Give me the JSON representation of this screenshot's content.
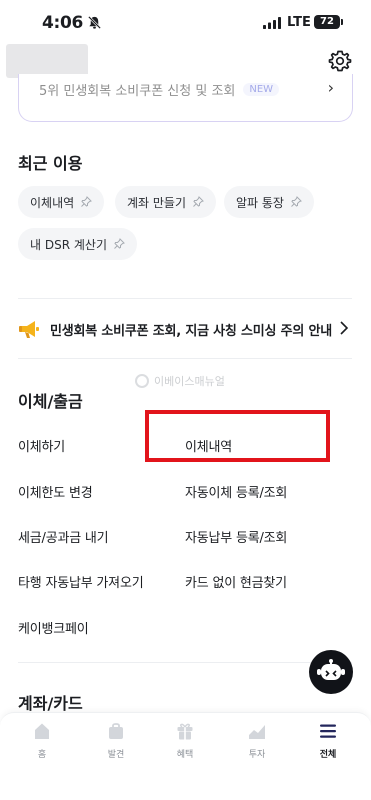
{
  "status_bar": {
    "time": "4:06",
    "network": "LTE",
    "battery": "72"
  },
  "notice_card": {
    "text": "5위 민생회복 소비쿠폰 신청 및 조회",
    "badge": "NEW",
    "chevron": "›"
  },
  "recent": {
    "title": "최근 이용",
    "chips": [
      {
        "label": "이체내역"
      },
      {
        "label": "계좌 만들기"
      },
      {
        "label": "알파 통장"
      },
      {
        "label": "내 DSR 계산기"
      }
    ]
  },
  "banner": {
    "text": "민생회복 소비쿠폰 조회, 지금 사칭 스미싱 주의 안내"
  },
  "watermark": {
    "text": "이베이스매뉴얼"
  },
  "transfer": {
    "title": "이체/출금",
    "items": [
      {
        "label": "이체하기"
      },
      {
        "label": "이체내역"
      },
      {
        "label": "이체한도 변경"
      },
      {
        "label": "자동이체 등록/조회"
      },
      {
        "label": "세금/공과금 내기"
      },
      {
        "label": "자동납부 등록/조회"
      },
      {
        "label": "타행 자동납부 가져오기"
      },
      {
        "label": "카드 없이 현금찾기"
      },
      {
        "label": "케이뱅크페이"
      }
    ]
  },
  "account_card": {
    "title": "계좌/카드"
  },
  "tabbar": {
    "tabs": [
      {
        "label": "홈",
        "icon": "home-icon"
      },
      {
        "label": "발견",
        "icon": "bag-icon"
      },
      {
        "label": "혜택",
        "icon": "gift-icon"
      },
      {
        "label": "투자",
        "icon": "chart-icon"
      },
      {
        "label": "전체",
        "icon": "menu-icon",
        "active": true
      }
    ]
  },
  "colors": {
    "accent": "#5b65d8",
    "highlight": "#e2141b",
    "text": "#1b1d21"
  }
}
